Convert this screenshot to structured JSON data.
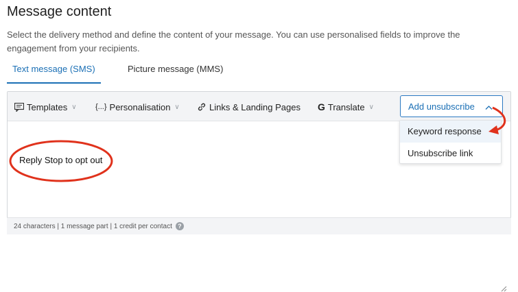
{
  "header": {
    "title": "Message content",
    "description": "Select the delivery method and define the content of your message. You can use personalised fields to improve the engagement from your recipients."
  },
  "tabs": [
    {
      "label": "Text message (SMS)",
      "active": true
    },
    {
      "label": "Picture message (MMS)",
      "active": false
    }
  ],
  "toolbar": {
    "templates_label": "Templates",
    "personalisation_label": "Personalisation",
    "links_label": "Links & Landing Pages",
    "translate_label": "Translate",
    "add_unsubscribe_label": "Add unsubscribe"
  },
  "dropdown": {
    "items": [
      "Keyword response",
      "Unsubscribe link"
    ]
  },
  "message": {
    "text": "Reply Stop to opt out"
  },
  "footer": {
    "stats": "24 characters | 1 message part | 1 credit per contact"
  },
  "colors": {
    "accent": "#1a6fb5",
    "annotation": "#e0321c"
  }
}
